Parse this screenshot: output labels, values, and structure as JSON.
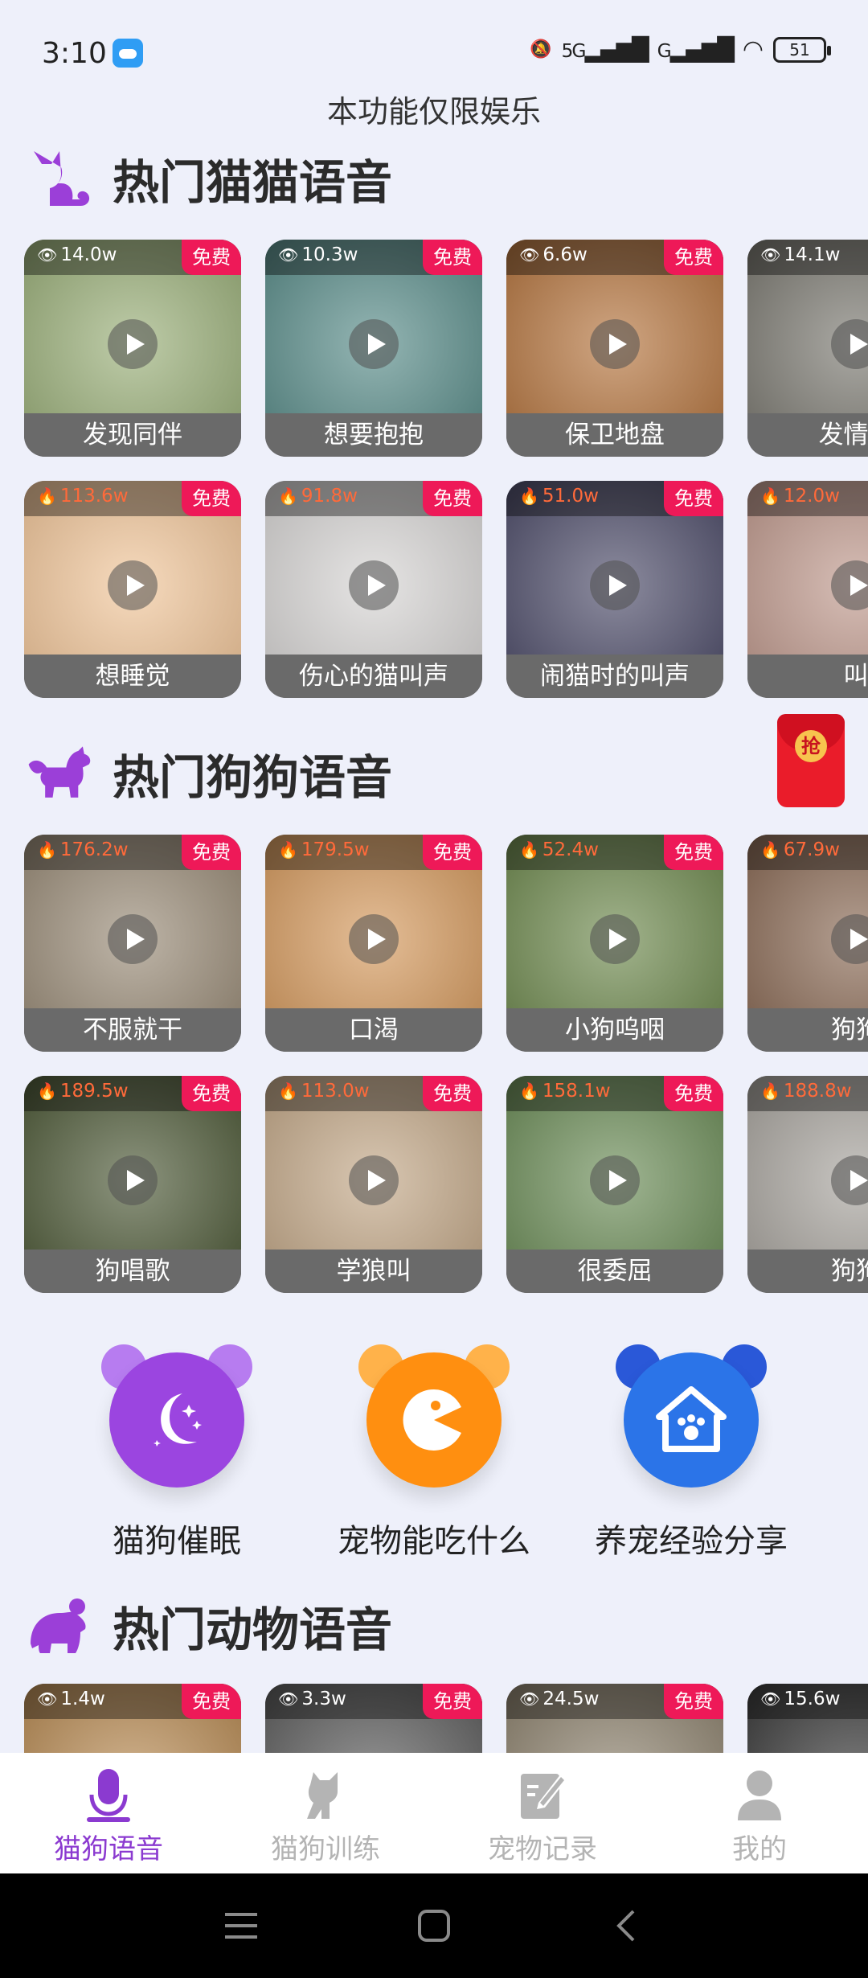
{
  "status": {
    "time": "3:10",
    "network": "5G",
    "network2": "G",
    "battery": "51"
  },
  "notice": "本功能仅限娱乐",
  "sections": {
    "cats": {
      "title": "热门猫猫语音"
    },
    "dogs": {
      "title": "热门狗狗语音"
    },
    "animals": {
      "title": "热门动物语音"
    }
  },
  "badge": "免费",
  "cat_rows": [
    [
      {
        "count": "14.0w",
        "type": "views",
        "caption": "发现同伴",
        "color": "#9bb07a"
      },
      {
        "count": "10.3w",
        "type": "views",
        "caption": "想要抱抱",
        "color": "#5a8d8a"
      },
      {
        "count": "6.6w",
        "type": "views",
        "caption": "保卫地盘",
        "color": "#b5753f"
      },
      {
        "count": "14.1w",
        "type": "views",
        "caption": "发情的",
        "color": "#7c7a72"
      }
    ],
    [
      {
        "count": "113.6w",
        "type": "hot",
        "caption": "想睡觉",
        "color": "#f1c69a"
      },
      {
        "count": "91.8w",
        "type": "hot",
        "caption": "伤心的猫叫声",
        "color": "#d7d5d4"
      },
      {
        "count": "51.0w",
        "type": "hot",
        "caption": "闹猫时的叫声",
        "color": "#4e4d6a"
      },
      {
        "count": "12.0w",
        "type": "hot",
        "caption": "叫",
        "color": "#c09a8e"
      }
    ]
  ],
  "dog_rows": [
    [
      {
        "count": "176.2w",
        "type": "hot",
        "caption": "不服就干",
        "color": "#9a8c78"
      },
      {
        "count": "179.5w",
        "type": "hot",
        "caption": "口渴",
        "color": "#d59a5e"
      },
      {
        "count": "52.4w",
        "type": "hot",
        "caption": "小狗呜咽",
        "color": "#6f8a4f"
      },
      {
        "count": "67.9w",
        "type": "hot",
        "caption": "狗狗",
        "color": "#8a6a55"
      }
    ],
    [
      {
        "count": "189.5w",
        "type": "hot",
        "caption": "狗唱歌",
        "color": "#4e5a38"
      },
      {
        "count": "113.0w",
        "type": "hot",
        "caption": "学狼叫",
        "color": "#c3a888"
      },
      {
        "count": "158.1w",
        "type": "hot",
        "caption": "很委屈",
        "color": "#6c8d58"
      },
      {
        "count": "188.8w",
        "type": "hot",
        "caption": "狗狗",
        "color": "#a8a49e"
      }
    ]
  ],
  "animal_row": [
    {
      "count": "1.4w",
      "type": "views",
      "caption": "",
      "color": "#b98c55"
    },
    {
      "count": "3.3w",
      "type": "views",
      "caption": "",
      "color": "#5e5e5e"
    },
    {
      "count": "24.5w",
      "type": "views",
      "caption": "",
      "color": "#8f8470"
    },
    {
      "count": "15.6w",
      "type": "views",
      "caption": "",
      "color": "#3b3b3b"
    }
  ],
  "redpack_label": "抢",
  "features": [
    {
      "label": "猫狗催眠",
      "icon": "moon-stars-icon",
      "color": "#9b45e0",
      "ear": "#b77cf0"
    },
    {
      "label": "宠物能吃什么",
      "icon": "pacman-icon",
      "color": "#ff8f10",
      "ear": "#ffb24a"
    },
    {
      "label": "养宠经验分享",
      "icon": "pet-house-icon",
      "color": "#2b74e8",
      "ear": "#2a58d8"
    }
  ],
  "tabs": [
    {
      "label": "猫狗语音",
      "icon": "microphone-icon",
      "active": true
    },
    {
      "label": "猫狗训练",
      "icon": "dog-icon",
      "active": false
    },
    {
      "label": "宠物记录",
      "icon": "edit-note-icon",
      "active": false
    },
    {
      "label": "我的",
      "icon": "user-icon",
      "active": false
    }
  ],
  "colors": {
    "accent": "#8b3ad0",
    "badge": "#ee1958",
    "hot": "#ff6a3a"
  }
}
